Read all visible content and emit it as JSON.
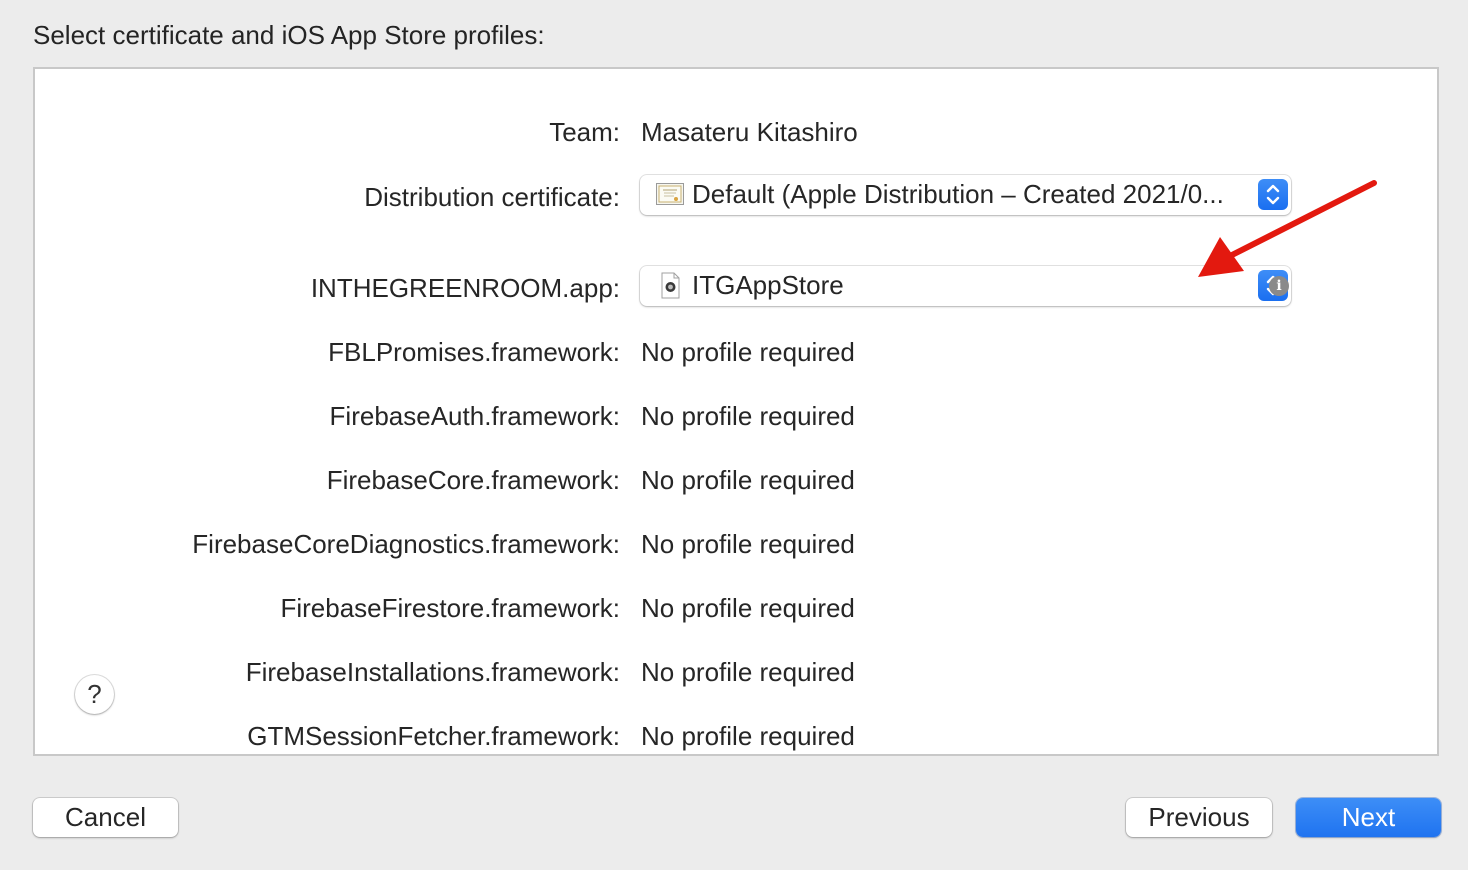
{
  "heading": "Select certificate and iOS App Store profiles:",
  "rows": {
    "team": {
      "label": "Team:",
      "value": "Masateru Kitashiro"
    },
    "certificate": {
      "label": "Distribution certificate:",
      "value": "Default (Apple Distribution – Created 2021/0..."
    },
    "app": {
      "label": "INTHEGREENROOM.app:",
      "value": "ITGAppStore"
    },
    "frameworks": [
      {
        "label": "FBLPromises.framework:",
        "value": "No profile required"
      },
      {
        "label": "FirebaseAuth.framework:",
        "value": "No profile required"
      },
      {
        "label": "FirebaseCore.framework:",
        "value": "No profile required"
      },
      {
        "label": "FirebaseCoreDiagnostics.framework:",
        "value": "No profile required"
      },
      {
        "label": "FirebaseFirestore.framework:",
        "value": "No profile required"
      },
      {
        "label": "FirebaseInstallations.framework:",
        "value": "No profile required"
      },
      {
        "label": "GTMSessionFetcher.framework:",
        "value": "No profile required"
      }
    ]
  },
  "help_label": "?",
  "info_label": "i",
  "buttons": {
    "cancel": "Cancel",
    "previous": "Previous",
    "next": "Next"
  },
  "icons": {
    "certificate": "certificate-icon",
    "profile": "provisioning-profile-icon",
    "stepper": "up-down-chevron-icon",
    "info": "info-icon",
    "annotation": "red-arrow-annotation"
  },
  "colors": {
    "accent": "#1f73f0",
    "annotation": "#e3190f",
    "window_bg": "#ececec",
    "panel_bg": "#ffffff"
  }
}
